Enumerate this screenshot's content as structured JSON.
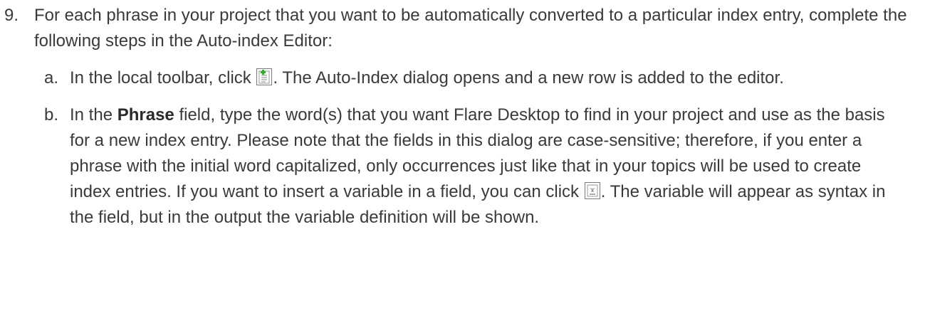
{
  "step9": {
    "number": "9.",
    "text": "For each phrase in your project that you want to be automatically converted to a particular index entry, complete the following steps in the Auto-index Editor:"
  },
  "substeps": [
    {
      "letter": "a.",
      "before_icon": "In the local toolbar, click ",
      "icon": "new-auto-index-icon",
      "after_icon": ". The Auto-Index dialog opens and a new row is added to the editor."
    },
    {
      "letter": "b.",
      "before_bold": "In the ",
      "bold": "Phrase",
      "after_bold": " field, type the word(s) that you want Flare Desktop to find in your project and use as the basis for a new index entry. Please note that the fields in this dialog are case-sensitive; therefore, if you enter a phrase with the initial word capitalized, only occurrences just like that in your topics will be used to create index entries. If you want to insert a variable in a field, you can click ",
      "icon": "insert-variable-icon",
      "after_icon": ". The variable will appear as syntax in the field, but in the output the variable definition will be shown."
    }
  ],
  "colors": {
    "text": "#3a3a3a",
    "icon_green": "#3aa93a",
    "icon_border": "#7a7a7a"
  }
}
